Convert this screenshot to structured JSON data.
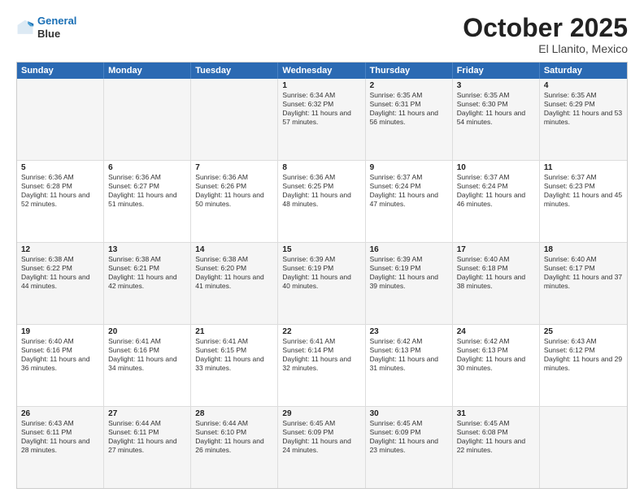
{
  "header": {
    "logo_line1": "General",
    "logo_line2": "Blue",
    "month": "October 2025",
    "location": "El Llanito, Mexico"
  },
  "weekdays": [
    "Sunday",
    "Monday",
    "Tuesday",
    "Wednesday",
    "Thursday",
    "Friday",
    "Saturday"
  ],
  "rows": [
    [
      {
        "day": "",
        "text": ""
      },
      {
        "day": "",
        "text": ""
      },
      {
        "day": "",
        "text": ""
      },
      {
        "day": "1",
        "text": "Sunrise: 6:34 AM\nSunset: 6:32 PM\nDaylight: 11 hours and 57 minutes."
      },
      {
        "day": "2",
        "text": "Sunrise: 6:35 AM\nSunset: 6:31 PM\nDaylight: 11 hours and 56 minutes."
      },
      {
        "day": "3",
        "text": "Sunrise: 6:35 AM\nSunset: 6:30 PM\nDaylight: 11 hours and 54 minutes."
      },
      {
        "day": "4",
        "text": "Sunrise: 6:35 AM\nSunset: 6:29 PM\nDaylight: 11 hours and 53 minutes."
      }
    ],
    [
      {
        "day": "5",
        "text": "Sunrise: 6:36 AM\nSunset: 6:28 PM\nDaylight: 11 hours and 52 minutes."
      },
      {
        "day": "6",
        "text": "Sunrise: 6:36 AM\nSunset: 6:27 PM\nDaylight: 11 hours and 51 minutes."
      },
      {
        "day": "7",
        "text": "Sunrise: 6:36 AM\nSunset: 6:26 PM\nDaylight: 11 hours and 50 minutes."
      },
      {
        "day": "8",
        "text": "Sunrise: 6:36 AM\nSunset: 6:25 PM\nDaylight: 11 hours and 48 minutes."
      },
      {
        "day": "9",
        "text": "Sunrise: 6:37 AM\nSunset: 6:24 PM\nDaylight: 11 hours and 47 minutes."
      },
      {
        "day": "10",
        "text": "Sunrise: 6:37 AM\nSunset: 6:24 PM\nDaylight: 11 hours and 46 minutes."
      },
      {
        "day": "11",
        "text": "Sunrise: 6:37 AM\nSunset: 6:23 PM\nDaylight: 11 hours and 45 minutes."
      }
    ],
    [
      {
        "day": "12",
        "text": "Sunrise: 6:38 AM\nSunset: 6:22 PM\nDaylight: 11 hours and 44 minutes."
      },
      {
        "day": "13",
        "text": "Sunrise: 6:38 AM\nSunset: 6:21 PM\nDaylight: 11 hours and 42 minutes."
      },
      {
        "day": "14",
        "text": "Sunrise: 6:38 AM\nSunset: 6:20 PM\nDaylight: 11 hours and 41 minutes."
      },
      {
        "day": "15",
        "text": "Sunrise: 6:39 AM\nSunset: 6:19 PM\nDaylight: 11 hours and 40 minutes."
      },
      {
        "day": "16",
        "text": "Sunrise: 6:39 AM\nSunset: 6:19 PM\nDaylight: 11 hours and 39 minutes."
      },
      {
        "day": "17",
        "text": "Sunrise: 6:40 AM\nSunset: 6:18 PM\nDaylight: 11 hours and 38 minutes."
      },
      {
        "day": "18",
        "text": "Sunrise: 6:40 AM\nSunset: 6:17 PM\nDaylight: 11 hours and 37 minutes."
      }
    ],
    [
      {
        "day": "19",
        "text": "Sunrise: 6:40 AM\nSunset: 6:16 PM\nDaylight: 11 hours and 36 minutes."
      },
      {
        "day": "20",
        "text": "Sunrise: 6:41 AM\nSunset: 6:16 PM\nDaylight: 11 hours and 34 minutes."
      },
      {
        "day": "21",
        "text": "Sunrise: 6:41 AM\nSunset: 6:15 PM\nDaylight: 11 hours and 33 minutes."
      },
      {
        "day": "22",
        "text": "Sunrise: 6:41 AM\nSunset: 6:14 PM\nDaylight: 11 hours and 32 minutes."
      },
      {
        "day": "23",
        "text": "Sunrise: 6:42 AM\nSunset: 6:13 PM\nDaylight: 11 hours and 31 minutes."
      },
      {
        "day": "24",
        "text": "Sunrise: 6:42 AM\nSunset: 6:13 PM\nDaylight: 11 hours and 30 minutes."
      },
      {
        "day": "25",
        "text": "Sunrise: 6:43 AM\nSunset: 6:12 PM\nDaylight: 11 hours and 29 minutes."
      }
    ],
    [
      {
        "day": "26",
        "text": "Sunrise: 6:43 AM\nSunset: 6:11 PM\nDaylight: 11 hours and 28 minutes."
      },
      {
        "day": "27",
        "text": "Sunrise: 6:44 AM\nSunset: 6:11 PM\nDaylight: 11 hours and 27 minutes."
      },
      {
        "day": "28",
        "text": "Sunrise: 6:44 AM\nSunset: 6:10 PM\nDaylight: 11 hours and 26 minutes."
      },
      {
        "day": "29",
        "text": "Sunrise: 6:45 AM\nSunset: 6:09 PM\nDaylight: 11 hours and 24 minutes."
      },
      {
        "day": "30",
        "text": "Sunrise: 6:45 AM\nSunset: 6:09 PM\nDaylight: 11 hours and 23 minutes."
      },
      {
        "day": "31",
        "text": "Sunrise: 6:45 AM\nSunset: 6:08 PM\nDaylight: 11 hours and 22 minutes."
      },
      {
        "day": "",
        "text": ""
      }
    ]
  ]
}
